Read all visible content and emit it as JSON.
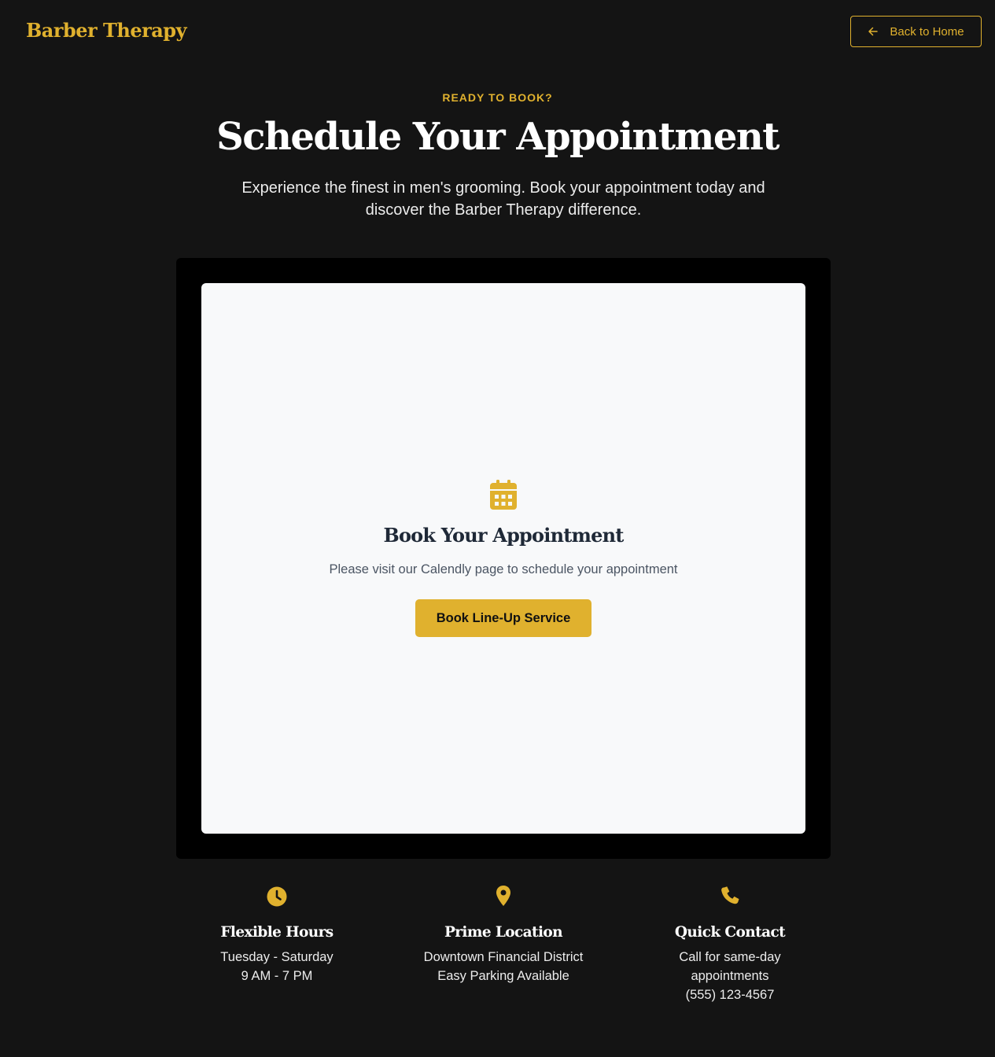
{
  "header": {
    "logo": "Barber Therapy",
    "back_label": "Back to Home"
  },
  "hero": {
    "eyebrow": "READY TO BOOK?",
    "title": "Schedule Your Appointment",
    "subtitle": "Experience the finest in men's grooming. Book your appointment today and discover the Barber Therapy difference."
  },
  "booking": {
    "icon": "calendar-icon",
    "title": "Book Your Appointment",
    "text": "Please visit our Calendly page to schedule your appointment",
    "button_label": "Book Line-Up Service"
  },
  "features": [
    {
      "icon": "clock-icon",
      "title": "Flexible Hours",
      "lines": [
        "Tuesday - Saturday",
        "9 AM - 7 PM"
      ]
    },
    {
      "icon": "map-pin-icon",
      "title": "Prime Location",
      "lines": [
        "Downtown Financial District",
        "Easy Parking Available"
      ]
    },
    {
      "icon": "phone-icon",
      "title": "Quick Contact",
      "lines": [
        "Call for same-day",
        "appointments",
        "(555) 123-4567"
      ]
    }
  ],
  "colors": {
    "accent": "#e0b12e",
    "background": "#141414",
    "panel": "#000000",
    "card": "#f8f9fa"
  }
}
